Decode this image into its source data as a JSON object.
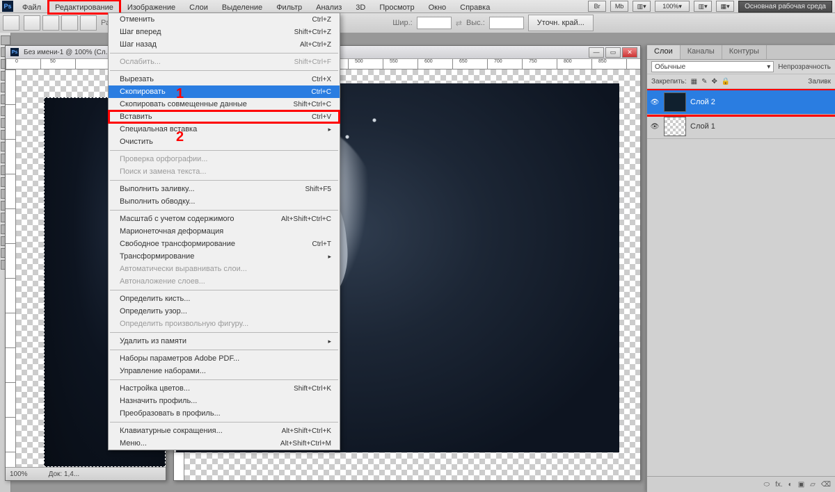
{
  "logo": "Ps",
  "menus": [
    "Файл",
    "Редактирование",
    "Изображение",
    "Слои",
    "Выделение",
    "Фильтр",
    "Анализ",
    "3D",
    "Просмотр",
    "Окно",
    "Справка"
  ],
  "workspace_button": "Основная рабочая среда",
  "chevrons": "≫",
  "right_toolbar": {
    "br": "Br",
    "mb": "Mb",
    "zoom": "100%"
  },
  "options_bar": {
    "feather_label": "Растуш...",
    "width_label": "Шир.:",
    "height_label": "Выс.:",
    "refine_button": "Уточн. край..."
  },
  "doc1": {
    "ps": "Ps",
    "title": "Без имени-1 @ 100% (Сл...",
    "ruler_marks": [
      "0",
      "50"
    ],
    "status_zoom": "100%",
    "status_doc": "Док: 1,4..."
  },
  "doc2": {
    "ruler_marks": [
      "500",
      "550",
      "600",
      "650",
      "700",
      "750",
      "800",
      "850"
    ]
  },
  "dropdown": [
    {
      "t": "Отменить",
      "s": "Ctrl+Z"
    },
    {
      "t": "Шаг вперед",
      "s": "Shift+Ctrl+Z"
    },
    {
      "t": "Шаг назад",
      "s": "Alt+Ctrl+Z"
    },
    {
      "sep": true
    },
    {
      "t": "Ослабить...",
      "s": "Shift+Ctrl+F",
      "d": true
    },
    {
      "sep": true
    },
    {
      "t": "Вырезать",
      "s": "Ctrl+X"
    },
    {
      "t": "Скопировать",
      "s": "Ctrl+C",
      "hl": true
    },
    {
      "t": "Скопировать совмещенные данные",
      "s": "Shift+Ctrl+C"
    },
    {
      "t": "Вставить",
      "s": "Ctrl+V",
      "red": true
    },
    {
      "t": "Специальная вставка",
      "arrow": true
    },
    {
      "t": "Очистить"
    },
    {
      "sep": true
    },
    {
      "t": "Проверка орфографии...",
      "d": true
    },
    {
      "t": "Поиск и замена текста...",
      "d": true
    },
    {
      "sep": true
    },
    {
      "t": "Выполнить заливку...",
      "s": "Shift+F5"
    },
    {
      "t": "Выполнить обводку..."
    },
    {
      "sep": true
    },
    {
      "t": "Масштаб с учетом содержимого",
      "s": "Alt+Shift+Ctrl+C"
    },
    {
      "t": "Марионеточная деформация"
    },
    {
      "t": "Свободное трансформирование",
      "s": "Ctrl+T"
    },
    {
      "t": "Трансформирование",
      "arrow": true
    },
    {
      "t": "Автоматически выравнивать слои...",
      "d": true
    },
    {
      "t": "Автоналожение слоев...",
      "d": true
    },
    {
      "sep": true
    },
    {
      "t": "Определить кисть..."
    },
    {
      "t": "Определить узор..."
    },
    {
      "t": "Определить произвольную фигуру...",
      "d": true
    },
    {
      "sep": true
    },
    {
      "t": "Удалить из памяти",
      "arrow": true
    },
    {
      "sep": true
    },
    {
      "t": "Наборы параметров Adobe PDF..."
    },
    {
      "t": "Управление наборами..."
    },
    {
      "sep": true
    },
    {
      "t": "Настройка цветов...",
      "s": "Shift+Ctrl+K"
    },
    {
      "t": "Назначить профиль..."
    },
    {
      "t": "Преобразовать в профиль..."
    },
    {
      "sep": true
    },
    {
      "t": "Клавиатурные сокращения...",
      "s": "Alt+Shift+Ctrl+K"
    },
    {
      "t": "Меню...",
      "s": "Alt+Shift+Ctrl+M"
    }
  ],
  "annotations": {
    "one": "1",
    "two": "2"
  },
  "layers_panel": {
    "tabs": [
      "Слои",
      "Каналы",
      "Контуры"
    ],
    "mode": "Обычные",
    "mode_arrow": "▾",
    "opacity_label": "Непрозрачность",
    "lock_label": "Закрепить:",
    "fill_label": "Заливк",
    "layers": [
      {
        "name": "Слой 2",
        "selected": true,
        "thumb": "dark"
      },
      {
        "name": "Слой 1",
        "selected": false,
        "thumb": "chk"
      }
    ],
    "footer_icons": [
      "⬭",
      "fx.",
      "◐",
      "▣",
      "▱",
      "⌫"
    ]
  }
}
